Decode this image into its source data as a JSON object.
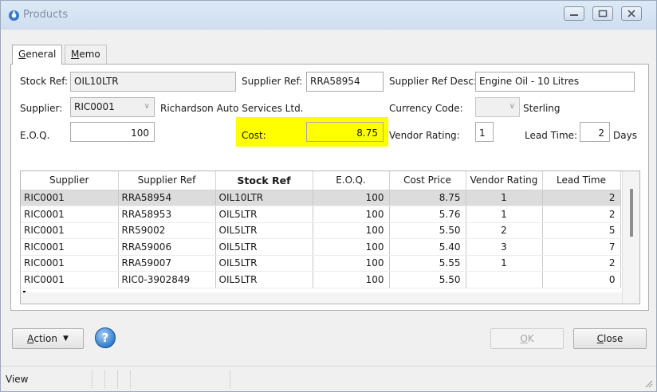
{
  "window": {
    "title": "Products"
  },
  "tabs": [
    {
      "label": "General",
      "accel": "G",
      "rest": "eneral"
    },
    {
      "label": "Memo",
      "accel": "M",
      "rest": "emo"
    }
  ],
  "form": {
    "stock_ref_label": "Stock Ref:",
    "stock_ref_value": "OIL10LTR",
    "supplier_ref_label": "Supplier Ref:",
    "supplier_ref_value": "RRA58954",
    "supplier_ref_desc_label": "Supplier Ref Desc:",
    "supplier_ref_desc_value": "Engine Oil - 10 Litres",
    "supplier_label": "Supplier:",
    "supplier_value": "RIC0001",
    "supplier_name": "Richardson Auto Services Ltd.",
    "currency_code_label": "Currency Code:",
    "currency_value": "Sterling",
    "eoq_label": "E.O.Q.",
    "eoq_value": "100",
    "cost_label": "Cost:",
    "cost_value": "8.75",
    "vendor_rating_label": "Vendor Rating:",
    "vendor_rating_value": "1",
    "lead_time_label": "Lead Time:",
    "lead_time_value": "2",
    "days_label": "Days"
  },
  "grid": {
    "columns": [
      "Supplier",
      "Supplier Ref",
      "Stock Ref",
      "E.O.Q.",
      "Cost Price",
      "Vendor Rating",
      "Lead Time"
    ],
    "rows": [
      [
        "RIC0001",
        "RRA58954",
        "OIL10LTR",
        "100",
        "8.75",
        "1",
        "2"
      ],
      [
        "RIC0001",
        "RRA58953",
        "OIL5LTR",
        "100",
        "5.76",
        "1",
        "2"
      ],
      [
        "RIC0001",
        "RR59002",
        "OIL5LTR",
        "100",
        "5.50",
        "2",
        "5"
      ],
      [
        "RIC0001",
        "RRA59006",
        "OIL5LTR",
        "100",
        "5.40",
        "3",
        "7"
      ],
      [
        "RIC0001",
        "RRA59007",
        "OIL5LTR",
        "100",
        "5.55",
        "1",
        "2"
      ],
      [
        "RIC0001",
        "RIC0-3902849",
        "OIL5LTR",
        "100",
        "5.50",
        "",
        "0"
      ]
    ]
  },
  "buttons": {
    "action": {
      "accel": "A",
      "rest": "ction"
    },
    "ok": {
      "accel": "O",
      "rest": "K"
    },
    "close": {
      "accel": "C",
      "rest": "lose"
    }
  },
  "status": {
    "text": "View"
  },
  "colors": {
    "highlight": "#ffff00",
    "selected_row": "#dcdcdc"
  }
}
